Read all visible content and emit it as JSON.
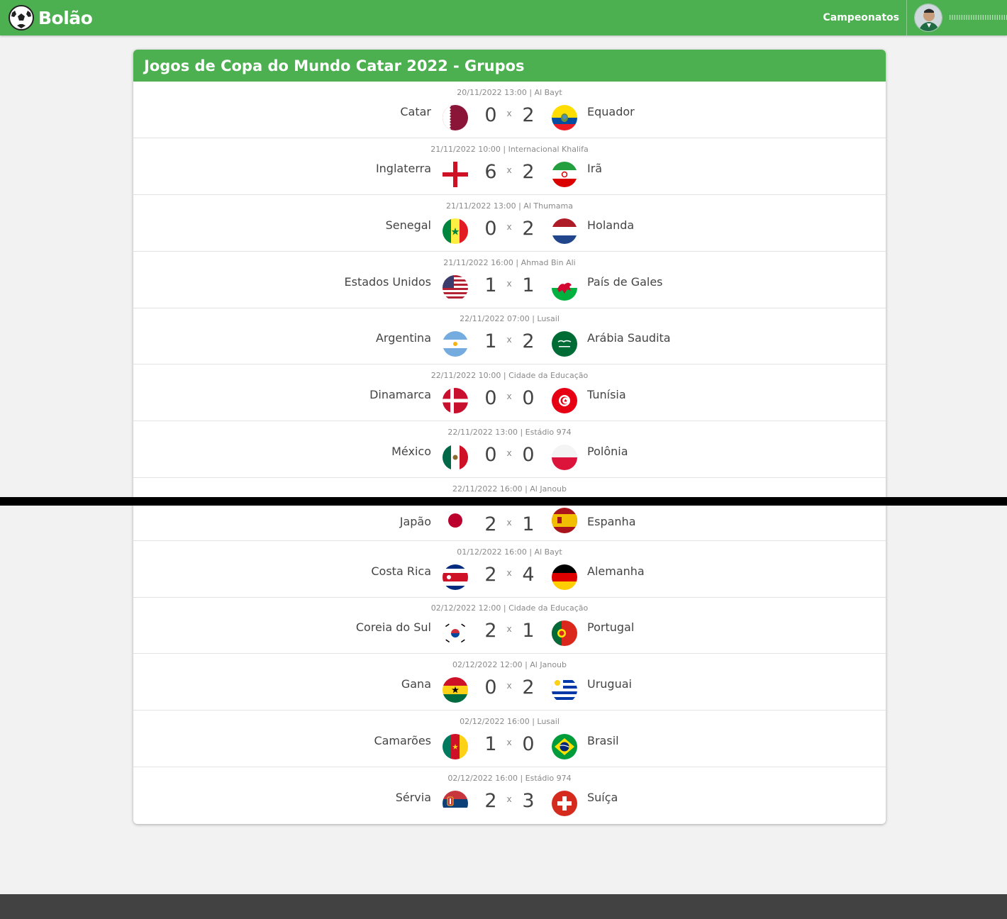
{
  "header": {
    "brand": "Bolão",
    "nav_link": "Campeonatos",
    "username": "ıııııııııııııııııııııııııııııı"
  },
  "card": {
    "title": "Jogos de Copa do Mundo Catar 2022 - Grupos"
  },
  "games": [
    {
      "meta": "20/11/2022 13:00 | Al Bayt",
      "home": "Catar",
      "home_flag": "qatar-flag",
      "home_score": "0",
      "away_score": "2",
      "away": "Equador",
      "away_flag": "ecuador-flag"
    },
    {
      "meta": "21/11/2022 10:00 | Internacional Khalifa",
      "home": "Inglaterra",
      "home_flag": "england-flag",
      "home_score": "6",
      "away_score": "2",
      "away": "Irã",
      "away_flag": "iran-flag"
    },
    {
      "meta": "21/11/2022 13:00 | Al Thumama",
      "home": "Senegal",
      "home_flag": "senegal-flag",
      "home_score": "0",
      "away_score": "2",
      "away": "Holanda",
      "away_flag": "netherlands-flag"
    },
    {
      "meta": "21/11/2022 16:00 | Ahmad Bin Ali",
      "home": "Estados Unidos",
      "home_flag": "usa-flag",
      "home_score": "1",
      "away_score": "1",
      "away": "País de Gales",
      "away_flag": "wales-flag"
    },
    {
      "meta": "22/11/2022 07:00 | Lusail",
      "home": "Argentina",
      "home_flag": "argentina-flag",
      "home_score": "1",
      "away_score": "2",
      "away": "Arábia Saudita",
      "away_flag": "saudi-arabia-flag"
    },
    {
      "meta": "22/11/2022 10:00 | Cidade da Educação",
      "home": "Dinamarca",
      "home_flag": "denmark-flag",
      "home_score": "0",
      "away_score": "0",
      "away": "Tunísia",
      "away_flag": "tunisia-flag"
    },
    {
      "meta": "22/11/2022 13:00 | Estádio 974",
      "home": "México",
      "home_flag": "mexico-flag",
      "home_score": "0",
      "away_score": "0",
      "away": "Polônia",
      "away_flag": "poland-flag"
    },
    {
      "meta": "22/11/2022 16:00 | Al Janoub",
      "home": "Japão",
      "home_flag": "japan-flag",
      "home_score": "2",
      "away_score": "1",
      "away": "Espanha",
      "away_flag": "spain-flag"
    },
    {
      "meta": "01/12/2022 16:00 | Al Bayt",
      "home": "Costa Rica",
      "home_flag": "costa-rica-flag",
      "home_score": "2",
      "away_score": "4",
      "away": "Alemanha",
      "away_flag": "germany-flag"
    },
    {
      "meta": "02/12/2022 12:00 | Cidade da Educação",
      "home": "Coreia do Sul",
      "home_flag": "south-korea-flag",
      "home_score": "2",
      "away_score": "1",
      "away": "Portugal",
      "away_flag": "portugal-flag"
    },
    {
      "meta": "02/12/2022 12:00 | Al Janoub",
      "home": "Gana",
      "home_flag": "ghana-flag",
      "home_score": "0",
      "away_score": "2",
      "away": "Uruguai",
      "away_flag": "uruguay-flag"
    },
    {
      "meta": "02/12/2022 16:00 | Lusail",
      "home": "Camarões",
      "home_flag": "cameroon-flag",
      "home_score": "1",
      "away_score": "0",
      "away": "Brasil",
      "away_flag": "brazil-flag"
    },
    {
      "meta": "02/12/2022 16:00 | Estádio 974",
      "home": "Sérvia",
      "home_flag": "serbia-flag",
      "home_score": "2",
      "away_score": "3",
      "away": "Suíça",
      "away_flag": "switzerland-flag"
    }
  ],
  "score_separator": "x",
  "colors": {
    "header_green": "#4caf50",
    "footer_dark": "#424242",
    "page_bg": "#f2f2f2"
  }
}
